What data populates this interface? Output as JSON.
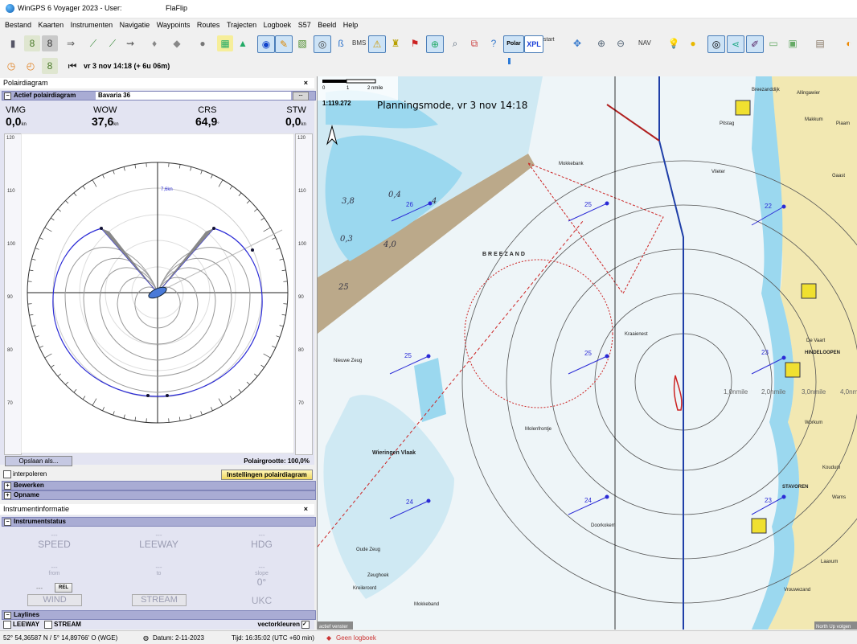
{
  "window": {
    "app_title": "WinGPS 6 Voyager 2023 - User:",
    "document": "FlaFlip"
  },
  "menu": [
    "Bestand",
    "Kaarten",
    "Instrumenten",
    "Navigatie",
    "Waypoints",
    "Routes",
    "Trajecten",
    "Logboek",
    "S57",
    "Beeld",
    "Help"
  ],
  "toolbar": {
    "bms_label": "BMS",
    "polar_label": "Polar",
    "xpl_label": "XPL",
    "start_label": "start",
    "nav_label": "NAV"
  },
  "time_bar": {
    "time": "vr 3 nov 14:18  (+ 6u 06m)"
  },
  "polar_panel": {
    "title": "Polairdiagram",
    "active_label": "Actief polairdiagram",
    "boat": "Bavaria 36",
    "metrics": [
      {
        "label": "VMG",
        "value": "0,0",
        "unit": "kn"
      },
      {
        "label": "WOW",
        "value": "37,6",
        "unit": "kn"
      },
      {
        "label": "CRS",
        "value": "64,9",
        "unit": "°"
      },
      {
        "label": "STW",
        "value": "0,0",
        "unit": "kn"
      }
    ],
    "scale_ticks": [
      "120",
      "110",
      "100",
      "90",
      "80",
      "70"
    ],
    "ring_label": "7,6kn",
    "save_button": "Opslaan als...",
    "polar_size": "Polairgrootte: 100,0%",
    "interpolate": "interpoleren",
    "settings_button": "Instellingen polairdiagram",
    "edit_section": "Bewerken",
    "record_section": "Opname"
  },
  "instrument_panel": {
    "title": "Instrumentinformatie",
    "status_label": "Instrumentstatus",
    "placeholder": "---",
    "speed": "SPEED",
    "leeway": "LEEWAY",
    "hdg": "HDG",
    "from": "from",
    "to": "to",
    "slope": "slope",
    "slope_value": "0°",
    "rel": "REL",
    "wind": "WIND",
    "stream": "STREAM",
    "ukc": "UKC",
    "laylines": "Laylines",
    "leeway_chk": "LEEWAY",
    "stream_chk": "STREAM",
    "vector_colors": "vectorkleuren"
  },
  "map": {
    "scale": "1:119.272",
    "scale_zero": "0",
    "scale_one": "1",
    "scale_unit": "2 nmile",
    "mode_title": "Planningsmode, vr 3 nov 14:18",
    "places": [
      "BREEZAND",
      "HINDELOOPEN",
      "STAVOREN",
      "Workum",
      "Makkum",
      "Gaast",
      "Piaam",
      "Allingawier",
      "Koudum",
      "Warns",
      "Laaxum",
      "Vrouwezand",
      "Oude Zeug",
      "Zeughoek",
      "Kreileroord",
      "Mokkeband",
      "Mokkebank",
      "De Vaart",
      "Pitstag",
      "Kraaienest",
      "Vlieter",
      "Wieringen Vlaak",
      "Nieuwe Zeug",
      "Molenfrontje",
      "Doorkokem",
      "Breezanddijk"
    ],
    "current_labels": [
      "26",
      "25",
      "22",
      "25",
      "23",
      "24",
      "24",
      "23",
      "25"
    ],
    "depths": [
      "3,8",
      "0,4",
      "4",
      "0,3",
      "4,0",
      "25"
    ],
    "range_labels": [
      "1,0nmile",
      "2,0nmile",
      "3,0nmile",
      "4,0nmile"
    ],
    "bottom_left_tag": "actief venster",
    "bottom_right_tag": "North Up volgen"
  },
  "status": {
    "position": "52° 54,36587 N / 5° 14,89766' O (WGE)",
    "date": "Datum: 2-11-2023",
    "time": "Tijd: 16:35:02 (UTC +60 min)",
    "log": "Geen logboek"
  },
  "colors": {
    "panel_header": "#a9acd4",
    "panel_bg": "#e3e4f2",
    "polar_blue": "#2b2bd6",
    "water": "#9bd8ef",
    "land": "#f2e8b2",
    "red_route": "#cc2222"
  }
}
